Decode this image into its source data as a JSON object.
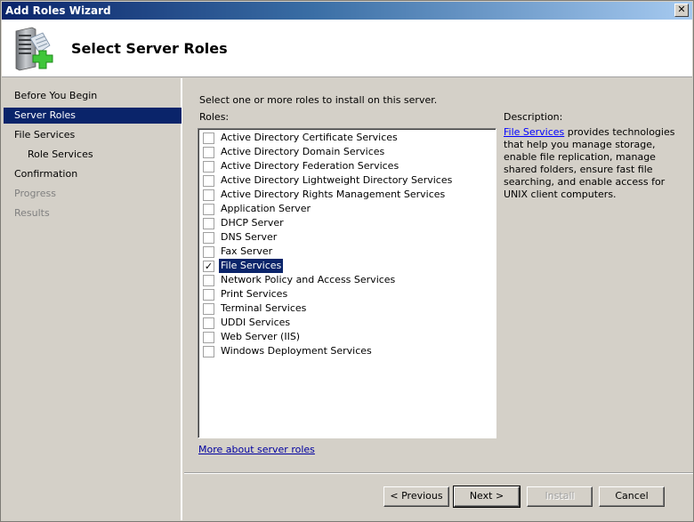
{
  "window": {
    "title": "Add Roles Wizard",
    "close_icon": "close-icon"
  },
  "header": {
    "title": "Select Server Roles",
    "icon": "server-add-icon"
  },
  "nav": {
    "items": [
      {
        "label": "Before You Begin",
        "state": "normal"
      },
      {
        "label": "Server Roles",
        "state": "active"
      },
      {
        "label": "File Services",
        "state": "normal"
      },
      {
        "label": "Role Services",
        "state": "sub"
      },
      {
        "label": "Confirmation",
        "state": "normal"
      },
      {
        "label": "Progress",
        "state": "disabled"
      },
      {
        "label": "Results",
        "state": "disabled"
      }
    ]
  },
  "main": {
    "instruction": "Select one or more roles to install on this server.",
    "roles_label": "Roles:",
    "roles": [
      {
        "label": "Active Directory Certificate Services",
        "checked": false,
        "selected": false
      },
      {
        "label": "Active Directory Domain Services",
        "checked": false,
        "selected": false
      },
      {
        "label": "Active Directory Federation Services",
        "checked": false,
        "selected": false
      },
      {
        "label": "Active Directory Lightweight Directory Services",
        "checked": false,
        "selected": false
      },
      {
        "label": "Active Directory Rights Management Services",
        "checked": false,
        "selected": false
      },
      {
        "label": "Application Server",
        "checked": false,
        "selected": false
      },
      {
        "label": "DHCP Server",
        "checked": false,
        "selected": false
      },
      {
        "label": "DNS Server",
        "checked": false,
        "selected": false
      },
      {
        "label": "Fax Server",
        "checked": false,
        "selected": false
      },
      {
        "label": "File Services",
        "checked": true,
        "selected": true
      },
      {
        "label": "Network Policy and Access Services",
        "checked": false,
        "selected": false
      },
      {
        "label": "Print Services",
        "checked": false,
        "selected": false
      },
      {
        "label": "Terminal Services",
        "checked": false,
        "selected": false
      },
      {
        "label": "UDDI Services",
        "checked": false,
        "selected": false
      },
      {
        "label": "Web Server (IIS)",
        "checked": false,
        "selected": false
      },
      {
        "label": "Windows Deployment Services",
        "checked": false,
        "selected": false
      }
    ],
    "description_label": "Description:",
    "description_link": "File Services",
    "description_text": " provides technologies that help you manage storage, enable file replication, manage shared folders, ensure fast file searching, and enable access for UNIX client computers.",
    "more_link": "More about server roles"
  },
  "buttons": {
    "previous": "< Previous",
    "next": "Next >",
    "install": "Install",
    "cancel": "Cancel"
  },
  "colors": {
    "selection": "#0a246a",
    "link": "#0000ff",
    "dialog_bg": "#d4d0c8"
  }
}
